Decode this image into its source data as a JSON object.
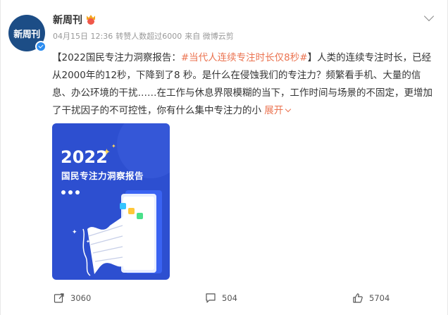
{
  "post": {
    "author": "新周刊",
    "avatar_text": "新周刊",
    "meta": {
      "date": "04月15日 12:36",
      "reposts_label": "转赞人数超过6000",
      "source": "来自 微博云剪"
    },
    "content": {
      "prefix": "【2022国民专注力洞察报告：",
      "hashtag": "#当代人连续专注时长仅8秒#",
      "body": "】人类的连续专注时长，已经从2000年的12秒，下降到了8 秒。是什么在侵蚀我们的专注力？频繁看手机、大量的信息、办公环境的干扰……在工作与休息界限模糊的当下，工作时间与场景的不固定，更增加了干扰因子的不可控性，你有什么集中专注力的小",
      "expand_label": "展开"
    },
    "card": {
      "year": "2022",
      "title": "国民专注力洞察报告"
    }
  },
  "actions": {
    "repost_count": "3060",
    "comment_count": "504",
    "like_count": "5704"
  },
  "colors": {
    "hashtag": "#eb7350",
    "card_bg": "#2d4fd0",
    "avatar_bg": "#1c4d86",
    "verified": "#2b8cf0"
  }
}
